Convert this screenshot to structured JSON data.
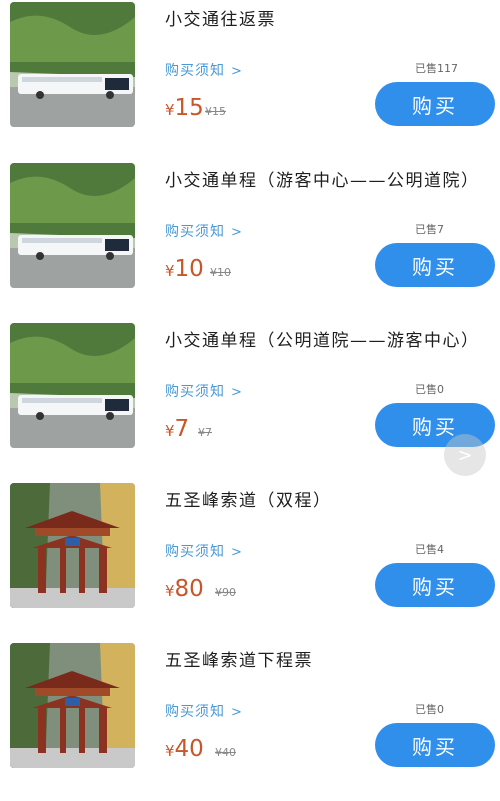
{
  "items": [
    {
      "title": "小交通往返票",
      "notice": "购买须知",
      "sold": "已售117",
      "currency": "¥",
      "price": "15",
      "original_price": "¥15",
      "buy_label": "购买",
      "image": "shuttle-bus"
    },
    {
      "title": "小交通单程（游客中心——公明道院）",
      "notice": "购买须知",
      "sold": "已售7",
      "currency": "¥",
      "price": "10",
      "original_price": "¥10",
      "buy_label": "购买",
      "image": "shuttle-bus"
    },
    {
      "title": "小交通单程（公明道院——游客中心）",
      "notice": "购买须知",
      "sold": "已售0",
      "currency": "¥",
      "price": "7",
      "original_price": "¥7",
      "buy_label": "购买",
      "image": "shuttle-bus"
    },
    {
      "title": "五圣峰索道（双程）",
      "notice": "购买须知",
      "sold": "已售4",
      "currency": "¥",
      "price": "80",
      "original_price": "¥90",
      "buy_label": "购买",
      "image": "temple-gate"
    },
    {
      "title": "五圣峰索道下程票",
      "notice": "购买须知",
      "sold": "已售0",
      "currency": "¥",
      "price": "40",
      "original_price": "¥40",
      "buy_label": "购买",
      "image": "temple-gate"
    }
  ],
  "icons": {
    "notice_arrow": "chevron-right-icon",
    "floating_button": "chevron-right-icon"
  },
  "colors": {
    "accent": "#2f8fea",
    "price": "#c7572a",
    "link": "#4a9ad6"
  }
}
